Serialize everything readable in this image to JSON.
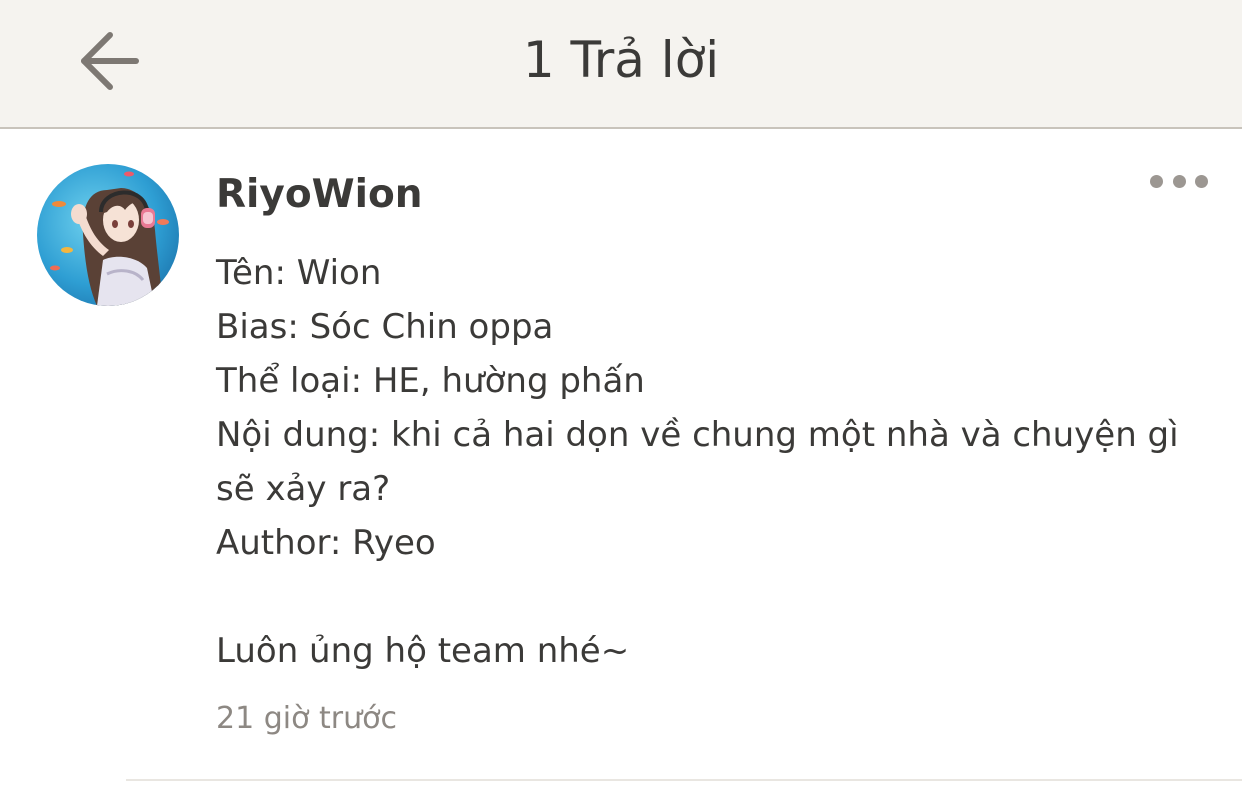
{
  "header": {
    "title": "1 Trả lời",
    "back_icon": "arrow-left-icon"
  },
  "comment": {
    "avatar_icon": "anime-girl-avatar",
    "username": "RiyoWion",
    "more_icon": "more-horizontal-icon",
    "lines": [
      "Tên:  Wion",
      "Bias: Sóc Chin oppa",
      "Thể loại: HE, hường phấn",
      "Nội dung: khi cả hai dọn về chung một nhà và chuyện gì",
      "sẽ xảy ra?",
      "Author: Ryeo",
      "",
      "Luôn ủng hộ team nhé~"
    ],
    "timestamp": "21 giờ trước"
  },
  "colors": {
    "header_bg": "#f5f3ef",
    "text": "#3b3a38",
    "muted": "#8d8883",
    "icon": "#9c9792"
  }
}
